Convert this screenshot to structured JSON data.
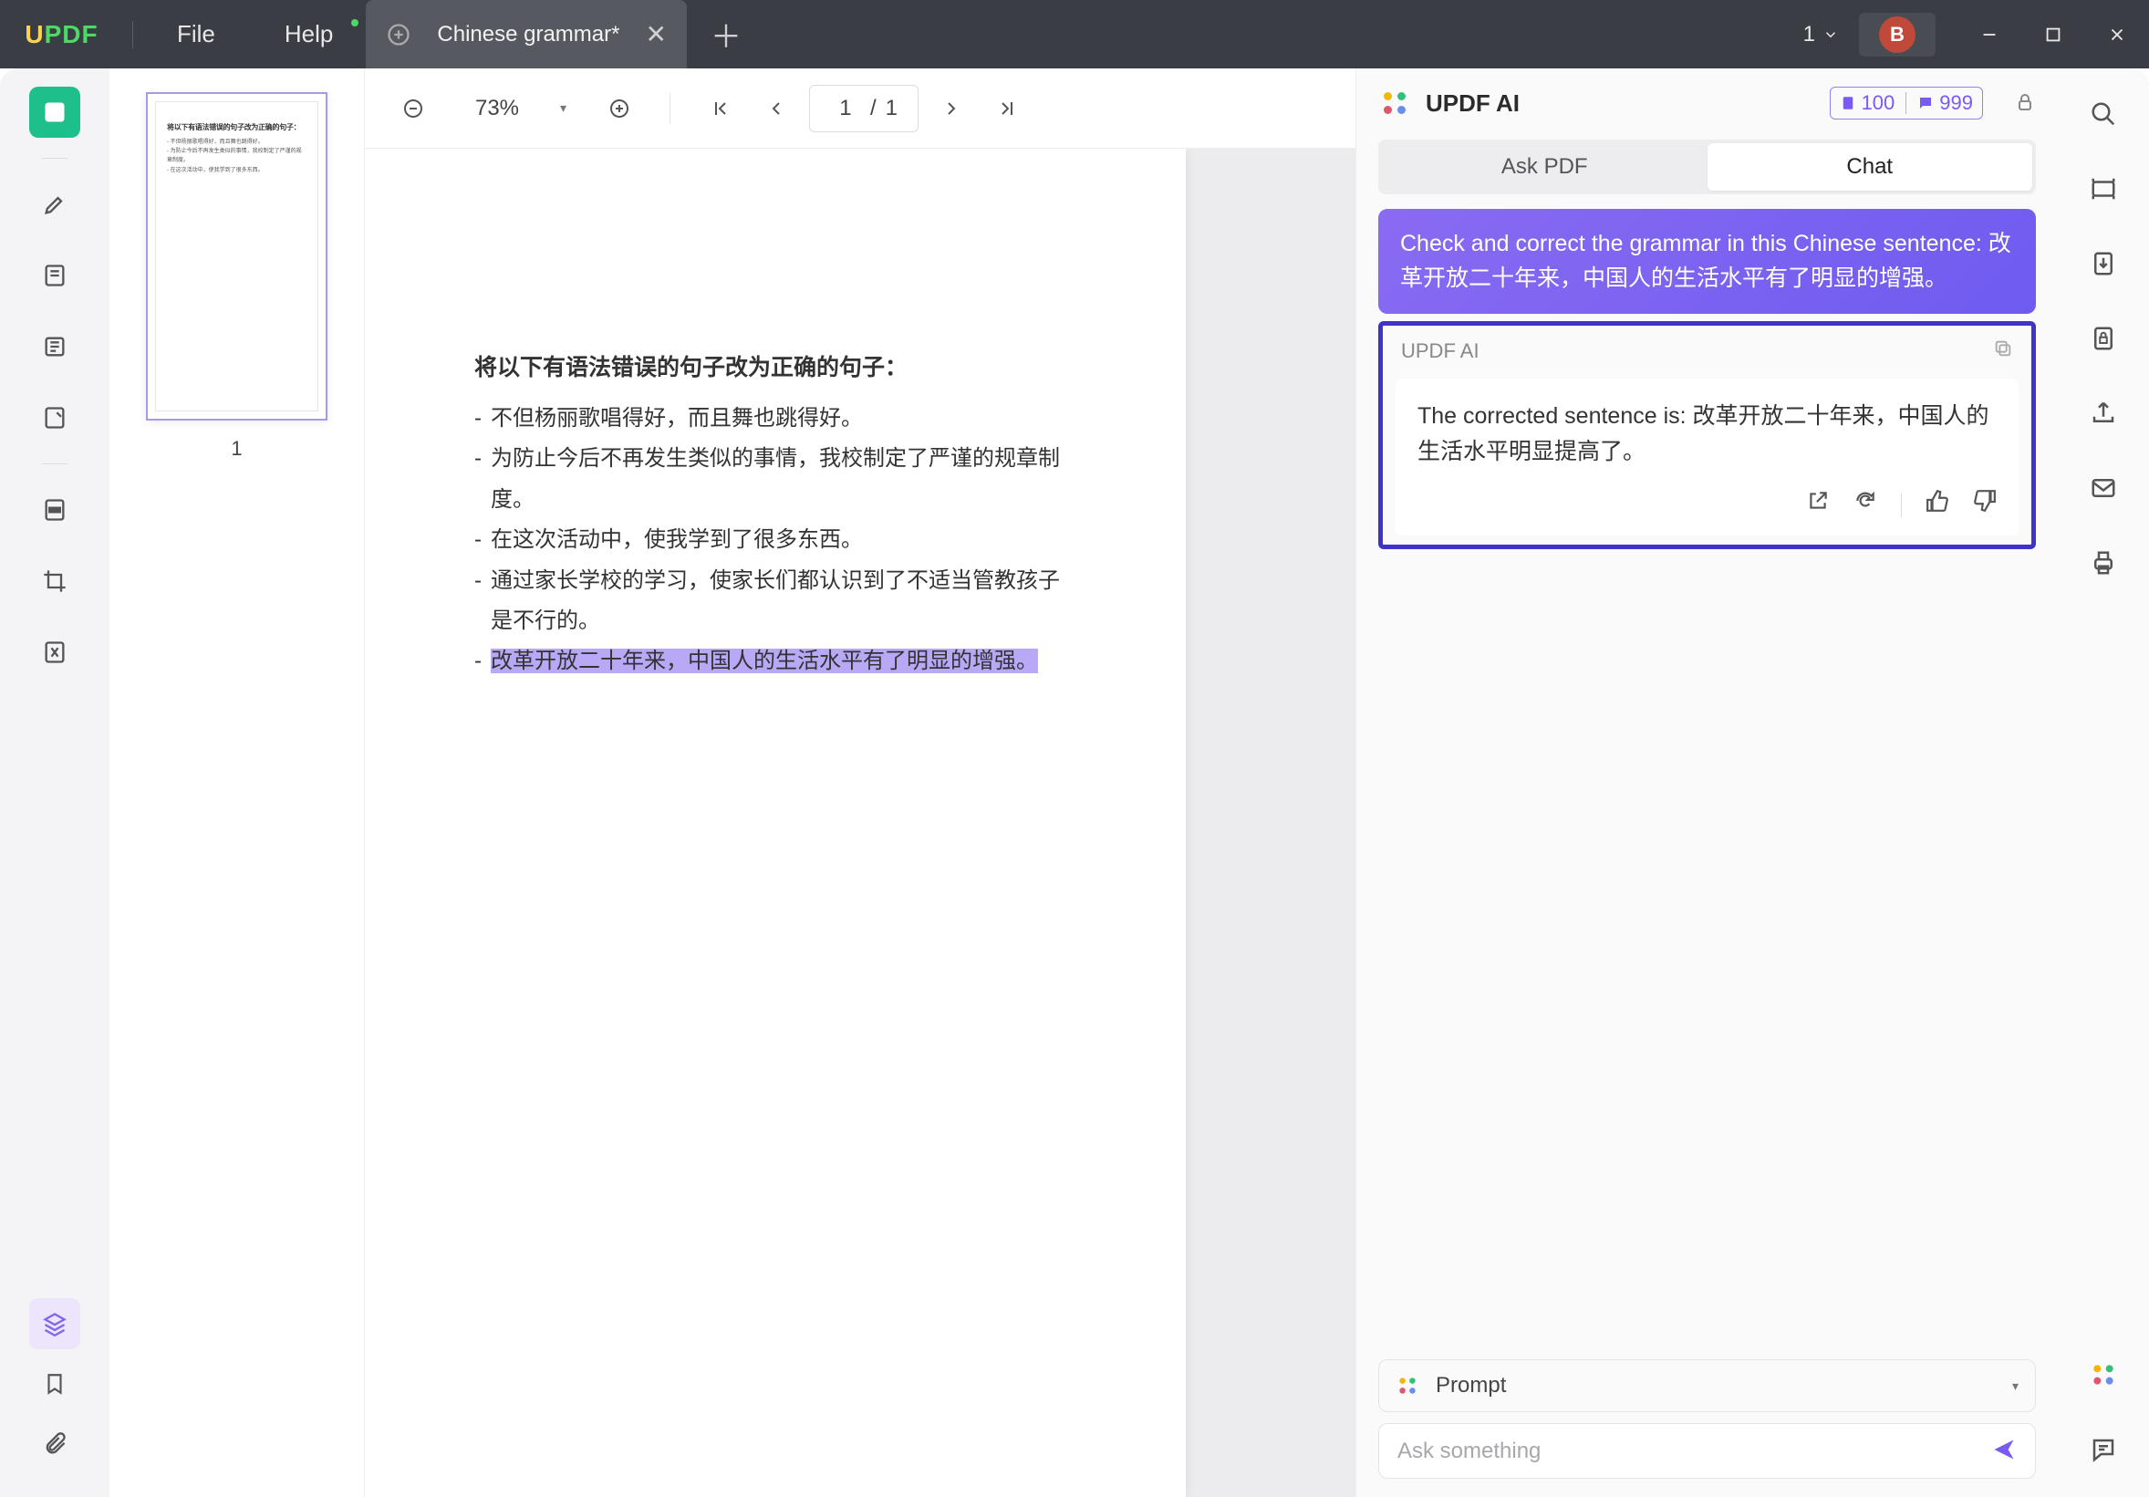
{
  "titlebar": {
    "logo": "UPDF",
    "menu": {
      "file": "File",
      "help": "Help"
    },
    "tab": {
      "title": "Chinese grammar*"
    },
    "dropdown_count": "1",
    "avatar_letter": "B"
  },
  "thumbnails": {
    "page_number": "1",
    "mini_title": "将以下有语法错误的句子改为正确的句子：",
    "mini_lines": [
      "- 不但杨丽歌唱得好，而且舞也跳得好。",
      "- 为防止今后不再发生类似的事情，我校制定了严谨的规章制度。",
      "- 在这次活动中，使我学到了很多东西。"
    ]
  },
  "toolbar": {
    "zoom": "73%",
    "page_current": "1",
    "page_sep": "/",
    "page_total": "1"
  },
  "document": {
    "title": "将以下有语法错误的句子改为正确的句子：",
    "lines": [
      "不但杨丽歌唱得好，而且舞也跳得好。",
      "为防止今后不再发生类似的事情，我校制定了严谨的规章制度。",
      "在这次活动中，使我学到了很多东西。",
      "通过家长学校的学习，使家长们都认识到了不适当管教孩子是不行的。",
      "改革开放二十年来，中国人的生活水平有了明显的增强。"
    ]
  },
  "ai": {
    "title": "UPDF AI",
    "credits": {
      "left": "100",
      "right": "999"
    },
    "tabs": {
      "ask_pdf": "Ask PDF",
      "chat": "Chat"
    },
    "user_message": "Check and correct the grammar in this Chinese sentence: 改革开放二十年来，中国人的生活水平有了明显的增强。",
    "reply_label": "UPDF AI",
    "reply_text": "The corrected sentence is: 改革开放二十年来，中国人的生活水平明显提高了。",
    "prompt_label": "Prompt",
    "ask_placeholder": "Ask something"
  }
}
